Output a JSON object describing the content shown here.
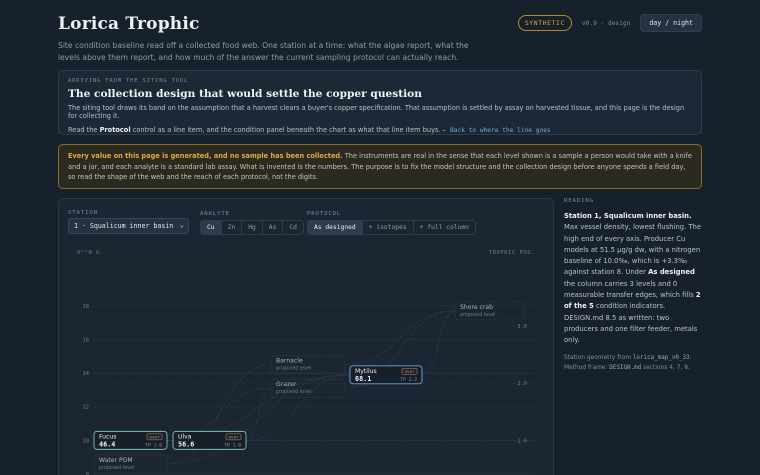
{
  "header": {
    "title": "Lorica Trophic",
    "lede": "Site condition baseline read off a collected food web. One station at a time: what the algae report, what the levels above them report, and how much of the answer the current sampling protocol can actually reach.",
    "badge_synthetic": "SYNTHETIC",
    "badge_version": "v0.9 · design",
    "mode_toggle": "day / night"
  },
  "arrive": {
    "kicker": "ARRIVING FROM THE SITING TOOL",
    "title": "The collection design that would settle the copper question",
    "p1": "The siting tool draws its band on the assumption that a harvest clears a buyer's copper specification. That assumption is settled by assay on harvested tissue, and this page is the design for collecting it.",
    "p2_before": "Read the ",
    "p2_bold": "Protocol",
    "p2_after": " control as a line item, and the condition panel beneath the chart as what that line item buys.",
    "back_link": "← Back to where the line goes"
  },
  "warning": {
    "bold": "Every value on this page is generated, and no sample has been collected.",
    "text": " The instruments are real in the sense that each level shown is a sample a person would take with a knife and a jar, and each analyte is a standard lab assay. What is invented is the numbers. The purpose is to fix the model structure and the collection design before anyone spends a field day, so read the shape of the web and the reach of each protocol, not the digits."
  },
  "controls": {
    "station_label": "STATION",
    "station_value": "1 · Squalicum inner basin",
    "analyte_label": "ANALYTE",
    "analytes": [
      "Cu",
      "Zn",
      "Hg",
      "As",
      "Cd"
    ],
    "analyte_selected": "Cu",
    "protocol_label": "PROTOCOL",
    "protocols": [
      "As designed",
      "+ isotopes",
      "+ full column"
    ],
    "protocol_selected": "As designed"
  },
  "chart_data": {
    "type": "scatter",
    "ylabel": "δ¹⁵N ‰",
    "y2label": "TROPHIC POS.",
    "ylim": [
      8,
      19
    ],
    "y_ticks": [
      8,
      10,
      12,
      14,
      16,
      18
    ],
    "y2_ticks": [
      {
        "tp": 1.0,
        "d15n": 10.0
      },
      {
        "tp": 2.0,
        "d15n": 13.4
      },
      {
        "tp": 3.0,
        "d15n": 16.8
      }
    ],
    "nodes": [
      {
        "name": "Fucus",
        "value": "46.4",
        "tag": "over",
        "tp": "TP 1.0",
        "d15n": 10.0,
        "col": 0,
        "status": "measured"
      },
      {
        "name": "Ulva",
        "value": "56.6",
        "tag": "over",
        "tp": "TP 1.0",
        "d15n": 10.0,
        "col": 1,
        "status": "measured"
      },
      {
        "name": "Water POM",
        "sub": "proposed level",
        "d15n": 8.6,
        "col": 0,
        "status": "proposed"
      },
      {
        "name": "Barnacle",
        "sub": "proposed level",
        "d15n": 14.5,
        "col": 2,
        "status": "proposed"
      },
      {
        "name": "Grazer",
        "sub": "proposed level",
        "d15n": 13.1,
        "col": 2,
        "status": "proposed"
      },
      {
        "name": "Mytilus",
        "value": "68.1",
        "tag": "over",
        "tp": "TP 2.2",
        "d15n": 13.9,
        "col": 3,
        "status": "measured"
      },
      {
        "name": "Shore crab",
        "sub": "proposed level",
        "d15n": 17.7,
        "col": 4,
        "status": "proposed"
      }
    ],
    "links": [
      [
        "Water POM",
        "Barnacle"
      ],
      [
        "Water POM",
        "Mytilus"
      ],
      [
        "Fucus",
        "Grazer"
      ],
      [
        "Ulva",
        "Grazer"
      ],
      [
        "Ulva",
        "Mytilus"
      ],
      [
        "Fucus",
        "Mytilus"
      ],
      [
        "Barnacle",
        "Shore crab"
      ],
      [
        "Grazer",
        "Shore crab"
      ],
      [
        "Mytilus",
        "Shore crab"
      ]
    ]
  },
  "reading": {
    "kicker": "READING",
    "b1": "Station 1, Squalicum inner basin.",
    "t1": " Max vessel density, lowest flushing. The high end of every axis. Producer Cu models at 51.5 µg/g dw, with a nitrogen baseline of 10.0‰, which is +3.3‰ against station 8. Under ",
    "b2": "As designed",
    "t2": " the column carries 3 levels and 0 measurable transfer edges, which fills ",
    "b3": "2 of the 5",
    "t3": " condition indicators. DESIGN.md 8.5 as written: two producers and one filter feeder, metals only.",
    "foot1": "Station geometry from ",
    "foot1_code": "lorica_map_v0_33",
    "foot1_end": ".",
    "foot2": "Method frame: ",
    "foot2_code": "DESIGN.md",
    "foot2_end": " sections 4, 7, 8."
  },
  "colors": {
    "measured_border": "#7fbfb0",
    "mytilus_border": "#6fa8dc",
    "over_tag": "#d08a76",
    "accent_warn": "#e0ab3e"
  }
}
